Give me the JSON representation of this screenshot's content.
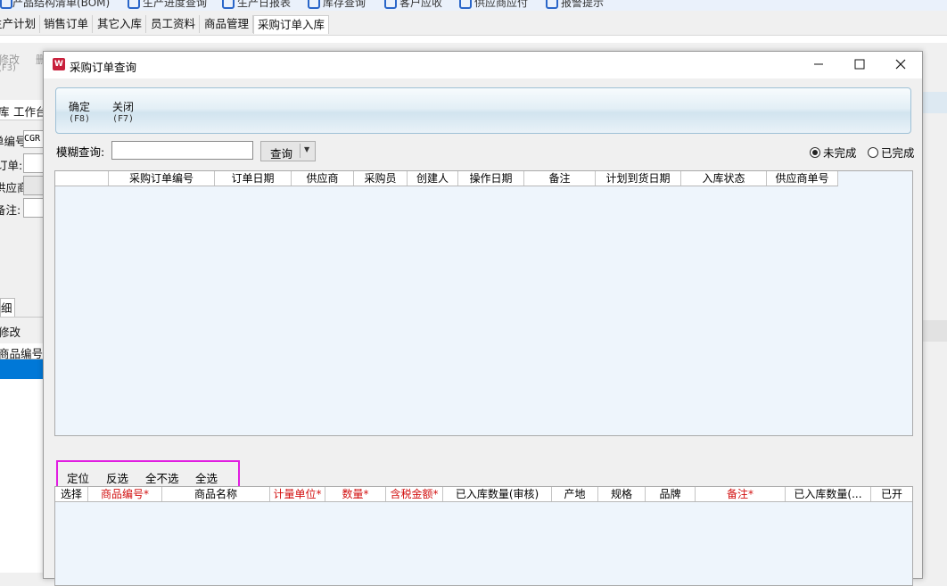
{
  "background": {
    "top_menu": [
      "产品结构清单(BOM)",
      "生产进度查询",
      "生产日报表",
      "库存查询",
      "客户应收",
      "供应商应付",
      "报警提示"
    ],
    "tabs": [
      "生产计划",
      "销售订单",
      "其它入库",
      "员工资料",
      "商品管理",
      "采购订单入库"
    ],
    "active_tab": "采购订单入库",
    "toolbar_left": [
      "修改",
      "(F3)",
      "删"
    ],
    "sub_tabs": [
      "库",
      "工作台"
    ],
    "form_labels": [
      "单编号:",
      "订单:",
      "供应商:",
      "备注:"
    ],
    "order_no_prefix": "CGR",
    "detail_tab": "细",
    "edit_label": "修改",
    "col_product_no": "商品编号"
  },
  "dialog": {
    "title": "采购订单查询",
    "toolbar": [
      {
        "label": "确定",
        "key": "(F8)"
      },
      {
        "label": "关闭",
        "key": "(F7)"
      }
    ],
    "search": {
      "label": "模糊查询:",
      "value": "",
      "button": "查询"
    },
    "status": {
      "options": [
        "未完成",
        "已完成"
      ],
      "selected": "未完成"
    },
    "order_columns": [
      "采购订单编号",
      "订单日期",
      "供应商",
      "采购员",
      "创建人",
      "操作日期",
      "备注",
      "计划到货日期",
      "入库状态",
      "供应商单号"
    ],
    "actions": [
      "定位",
      "反选",
      "全不选",
      "全选"
    ],
    "detail_columns": [
      {
        "label": "选择",
        "required": false
      },
      {
        "label": "商品编号*",
        "required": true
      },
      {
        "label": "商品名称",
        "required": false
      },
      {
        "label": "计量单位*",
        "required": true
      },
      {
        "label": "数量*",
        "required": true
      },
      {
        "label": "含税金额*",
        "required": true
      },
      {
        "label": "已入库数量(审核)",
        "required": false
      },
      {
        "label": "产地",
        "required": false
      },
      {
        "label": "规格",
        "required": false
      },
      {
        "label": "品牌",
        "required": false
      },
      {
        "label": "备注*",
        "required": true
      },
      {
        "label": "已入库数量(...",
        "required": false
      },
      {
        "label": "已开",
        "required": false
      }
    ]
  },
  "colors": {
    "accent_blue": "#0078d7",
    "highlight": "#e11de1",
    "required_text": "#d21010"
  }
}
